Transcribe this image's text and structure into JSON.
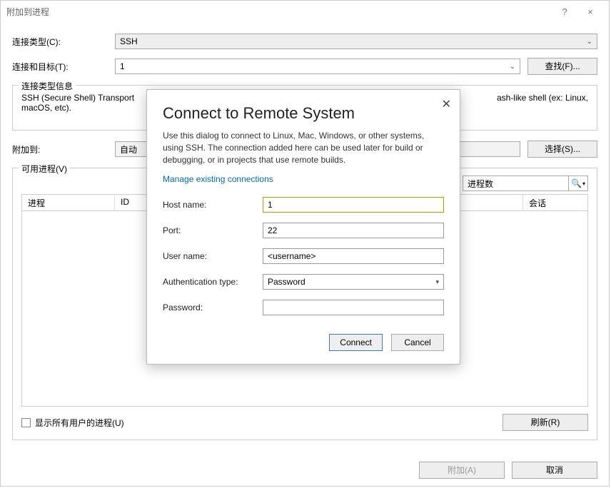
{
  "window": {
    "title": "附加到进程",
    "help_icon": "?",
    "close_icon": "×"
  },
  "form": {
    "conn_type_label": "连接类型(C):",
    "conn_type_value": "SSH",
    "conn_target_label": "连接和目标(T):",
    "conn_target_value": "1",
    "find_btn": "查找(F)..."
  },
  "conn_info": {
    "legend": "连接类型信息",
    "text_left": "SSH (Secure Shell) Transport",
    "text_right": "ash-like shell (ex: Linux,",
    "text2": "macOS, etc)."
  },
  "attach": {
    "label": "附加到:",
    "value_prefix": "自动",
    "select_btn": "选择(S)..."
  },
  "procs": {
    "legend": "可用进程(V)",
    "filter_label": "进程数",
    "col_proc": "进程",
    "col_id": "ID",
    "col_session": "会话"
  },
  "checkbox": {
    "label": "显示所有用户的进程(U)"
  },
  "refresh_btn": "刷新(R)",
  "footer": {
    "attach_btn": "附加(A)",
    "cancel_btn": "取消"
  },
  "modal": {
    "title": "Connect to Remote System",
    "desc": "Use this dialog to connect to Linux, Mac, Windows, or other systems, using SSH. The connection added here can be used later for build or debugging, or in projects that use remote builds.",
    "manage_link": "Manage existing connections",
    "host_label": "Host name:",
    "host_value": "1",
    "port_label": "Port:",
    "port_value": "22",
    "user_label": "User name:",
    "user_value": "<username>",
    "auth_label": "Authentication type:",
    "auth_value": "Password",
    "pass_label": "Password:",
    "pass_value": "",
    "connect_btn": "Connect",
    "cancel_btn": "Cancel"
  }
}
